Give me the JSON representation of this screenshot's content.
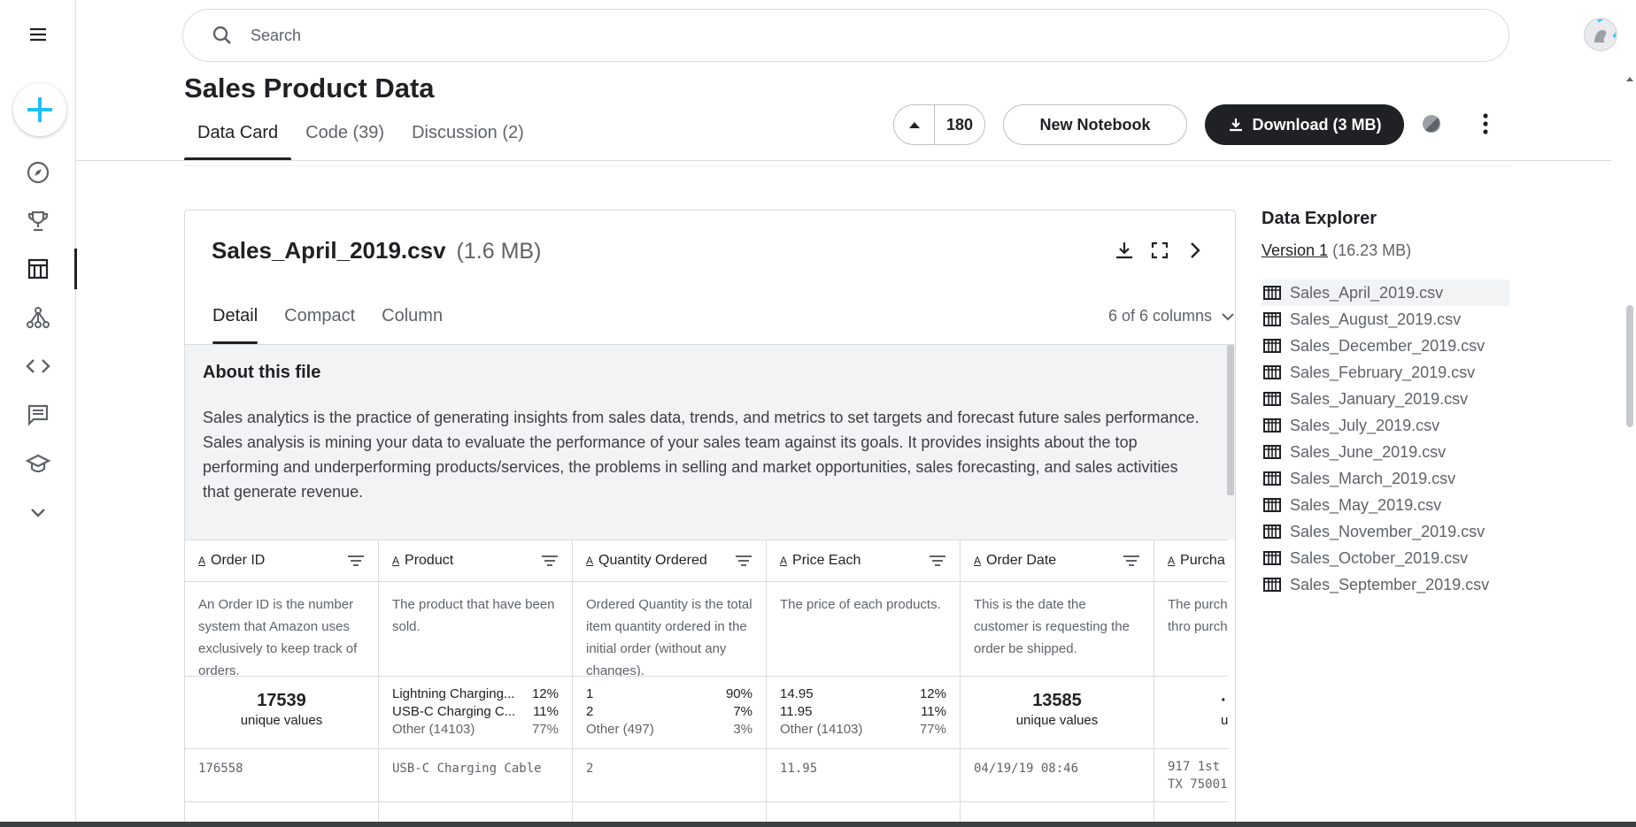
{
  "search": {
    "placeholder": "Search"
  },
  "dataset": {
    "title": "Sales Product Data",
    "tabs": [
      {
        "label": "Data Card",
        "active": true
      },
      {
        "label": "Code (39)",
        "active": false
      },
      {
        "label": "Discussion (2)",
        "active": false
      }
    ],
    "upvotes": "180",
    "new_notebook_label": "New Notebook",
    "download_label": "Download (3 MB)"
  },
  "file": {
    "name": "Sales_April_2019.csv",
    "size": "(1.6 MB)",
    "view_tabs": [
      {
        "label": "Detail",
        "active": true
      },
      {
        "label": "Compact",
        "active": false
      },
      {
        "label": "Column",
        "active": false
      }
    ],
    "column_count": "6 of 6 columns",
    "about_title": "About this file",
    "about_text": "Sales analytics is the practice of generating insights from sales data, trends, and metrics to set targets and forecast future sales performance. Sales analysis is mining your data to evaluate the performance of your sales team against its goals. It provides insights about the top performing and underperforming products/services, the problems in selling and market opportunities, sales forecasting, and sales activities that generate revenue."
  },
  "columns": [
    {
      "name": "Order ID",
      "desc": "An Order ID is the number system that Amazon uses exclusively to keep track of orders.",
      "unique": "17539",
      "unique_label": "unique values",
      "first_value": "176558"
    },
    {
      "name": "Product",
      "desc": "The product that have been sold.",
      "dist": [
        {
          "k": "Lightning Charging...",
          "v": "12%"
        },
        {
          "k": "USB-C Charging C...",
          "v": "11%"
        },
        {
          "k": "Other (14103)",
          "v": "77%"
        }
      ],
      "first_value": "USB-C Charging Cable"
    },
    {
      "name": "Quantity Ordered",
      "desc": "Ordered Quantity is the total item quantity ordered in the initial order (without any changes).",
      "dist": [
        {
          "k": "1",
          "v": "90%"
        },
        {
          "k": "2",
          "v": "7%"
        },
        {
          "k": "Other (497)",
          "v": "3%"
        }
      ],
      "first_value": "2"
    },
    {
      "name": "Price Each",
      "desc": "The price of each products.",
      "dist": [
        {
          "k": "14.95",
          "v": "12%"
        },
        {
          "k": "11.95",
          "v": "11%"
        },
        {
          "k": "Other (14103)",
          "v": "77%"
        }
      ],
      "first_value": "11.95"
    },
    {
      "name": "Order Date",
      "desc": "This is the date the customer is requesting the order be shipped.",
      "unique": "13585",
      "unique_label": "unique values",
      "first_value": "04/19/19 08:46"
    },
    {
      "name": "Purcha",
      "desc": "The purch prepared often thro purchasin",
      "unique": "·",
      "unique_label": "uni",
      "first_value": "917 1st",
      "first_value_2": "TX 75001"
    }
  ],
  "explorer": {
    "title": "Data Explorer",
    "version_link": "Version 1",
    "version_size": "(16.23 MB)",
    "files": [
      "Sales_April_2019.csv",
      "Sales_August_2019.csv",
      "Sales_December_2019.csv",
      "Sales_February_2019.csv",
      "Sales_January_2019.csv",
      "Sales_July_2019.csv",
      "Sales_June_2019.csv",
      "Sales_March_2019.csv",
      "Sales_May_2019.csv",
      "Sales_November_2019.csv",
      "Sales_October_2019.csv",
      "Sales_September_2019.csv"
    ],
    "selected_index": 0
  },
  "sidebar": {
    "icons": [
      "menu-icon",
      "create-icon",
      "compass-icon",
      "trophy-icon",
      "table-icon",
      "models-icon",
      "code-icon",
      "comments-icon",
      "learn-icon",
      "chevron-down-icon"
    ],
    "active": "table-icon"
  },
  "colors": {
    "accent": "#20BEFF",
    "dark": "#202124",
    "muted": "#5f6368"
  }
}
